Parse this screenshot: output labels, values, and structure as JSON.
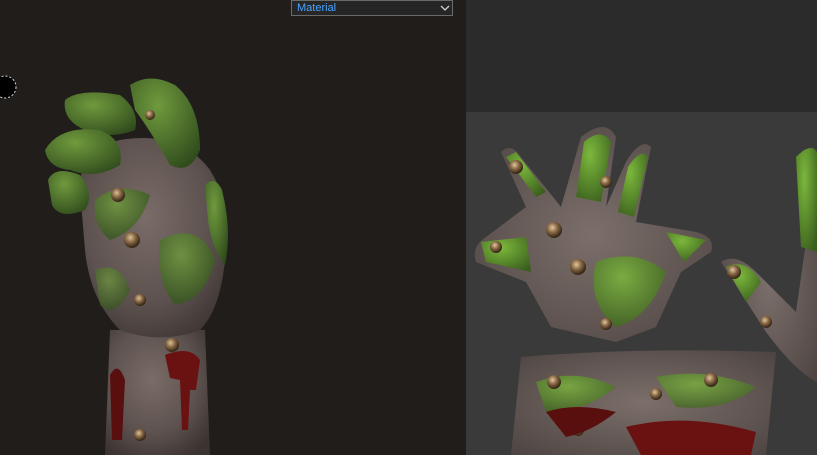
{
  "material_dropdown": {
    "selected": "Material"
  },
  "colors": {
    "accent_text": "#4aa3ff",
    "viewport_bg": "#201d1b",
    "uv_bg": "#3a3a3a",
    "skin_green": "#4f7a2e",
    "skin_grey": "#6e625f",
    "blood": "#5a0f0f"
  },
  "icons": {
    "dropdown": "chevron-down-icon",
    "brush": "brush-cursor-icon"
  }
}
